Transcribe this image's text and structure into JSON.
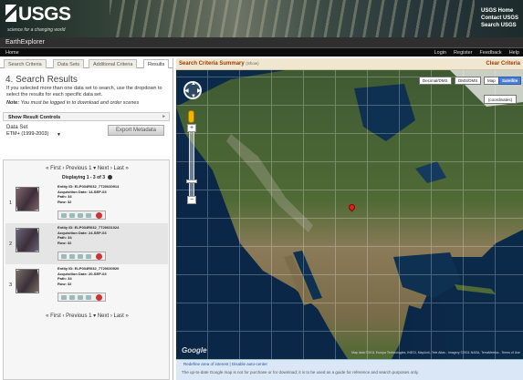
{
  "header": {
    "logo_text": "USGS",
    "tagline": "science for a changing world",
    "links": [
      "USGS Home",
      "Contact USGS",
      "Search USGS"
    ]
  },
  "app_title": "EarthExplorer",
  "nav": {
    "home": "Home",
    "right_links": [
      "Login",
      "Register",
      "Feedback",
      "Help"
    ]
  },
  "tabs": [
    "Search Criteria",
    "Data Sets",
    "Additional Criteria",
    "Results"
  ],
  "active_tab": "Results",
  "results": {
    "heading": "4. Search Results",
    "help": "If you selected more than one data set to search, use the dropdown to select the results for each specific data set.",
    "note_label": "Note:",
    "note_text": "You must be logged in to download and order scenes",
    "show_controls": "Show Result Controls",
    "dataset_label": "Data Set",
    "dataset_value": "ETM+ (1999-2003)",
    "export_button": "Export Metadata",
    "pager_top": "« First ‹ Previous  1  ▾ Next › Last »",
    "pager_bottom": "« First ‹ Previous  1  ▾ Next › Last »",
    "displaying": "Displaying 1 - 3 of 3",
    "items": [
      {
        "num": "1",
        "entity": "Entity ID: ELP034R032_7T20030914",
        "date": "Acquisition Date: 14-SEP-03",
        "path": "Path: 34",
        "row": "Row: 32",
        "thumb_color": "#8b6b72"
      },
      {
        "num": "2",
        "entity": "Entity ID: ELP034R032_7T20031024",
        "date": "Acquisition Date: 24-SEP-03",
        "path": "Path: 34",
        "row": "Row: 32",
        "thumb_color": "#6f6a80"
      },
      {
        "num": "3",
        "entity": "Entity ID: ELP034R032_7T20030920",
        "date": "Acquisition Date: 20-SEP-03",
        "path": "Path: 34",
        "row": "Row: 32",
        "thumb_color": "#7e7868"
      }
    ]
  },
  "map": {
    "summary_title": "Search Criteria Summary",
    "summary_hint": "(Show)",
    "clear": "Clear Criteria",
    "buttons": [
      "Decimal/DMS",
      "DMS/DMS",
      "Map",
      "Satellite"
    ],
    "active_button": "Satellite",
    "coords_label": "(coordinates)",
    "google": "Google",
    "copyright": "Map data ©2011 Europa Technologies, INEGI, MapLink, Tele Atlas - Imagery ©2011 NASA, TerraMetrics - Terms of Use",
    "footer_links": "Redefine area of interest  |  Disable auto-center",
    "disclaimer": "The up-to-date Google map is not for purchase or for download; it is to be used as a guide for reference and search purposes only."
  },
  "colors": {
    "accent": "#9a3b00",
    "active_map_button": "#4a7fd1",
    "marker": "#dd2222"
  }
}
